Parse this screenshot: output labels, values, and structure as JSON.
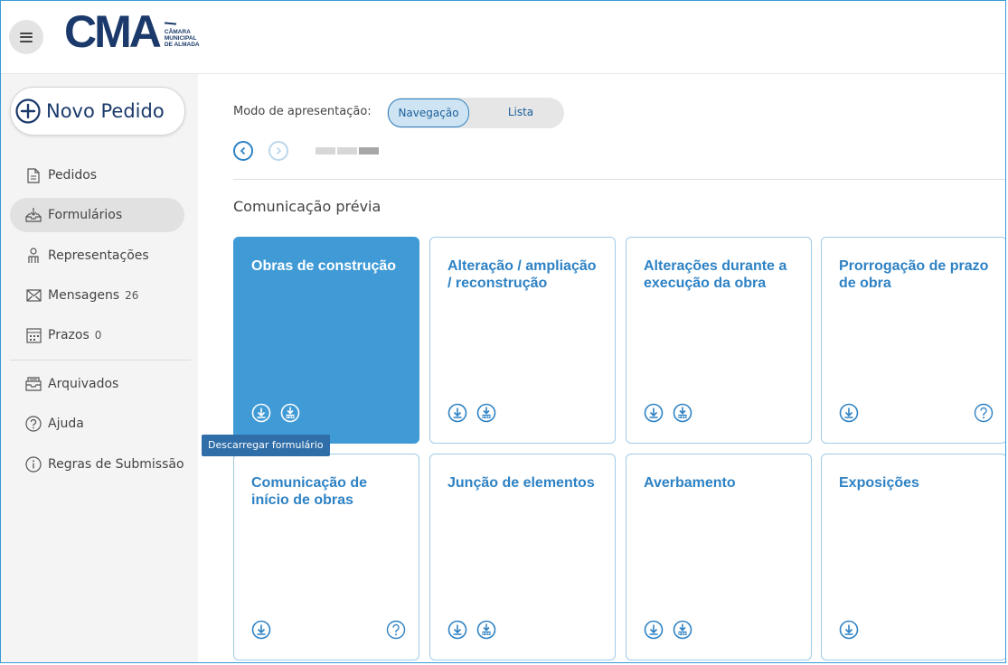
{
  "header": {
    "logo_text": "CMA",
    "logo_sub_lines": [
      "CÂMARA",
      "MUNICIPAL",
      "DE ALMADA"
    ]
  },
  "sidebar": {
    "new_request_label": "Novo Pedido",
    "items": [
      {
        "label": "Pedidos",
        "icon": "document-icon"
      },
      {
        "label": "Formulários",
        "icon": "inbox-download-icon",
        "active": true
      },
      {
        "label": "Representações",
        "icon": "person-icon"
      },
      {
        "label": "Mensagens",
        "count": "26",
        "icon": "envelope-icon"
      },
      {
        "label": "Prazos",
        "count": "0",
        "icon": "calendar-icon"
      },
      {
        "label": "Arquivados",
        "icon": "archive-icon"
      },
      {
        "label": "Ajuda",
        "icon": "question-icon"
      },
      {
        "label": "Regras de Submissão",
        "icon": "info-icon"
      }
    ]
  },
  "main": {
    "mode_label": "Modo de apresentação:",
    "mode_options": [
      "Navegação",
      "Lista"
    ],
    "mode_selected": "Navegação",
    "section_title": "Comunicação prévia",
    "cards": [
      {
        "title": "Obras de construção",
        "selected": true,
        "pdf": true,
        "help": false
      },
      {
        "title": "Alteração / ampliação / reconstrução",
        "pdf": true,
        "help": false
      },
      {
        "title": "Alterações durante a execução da obra",
        "pdf": true,
        "help": false
      },
      {
        "title": "Prorrogação de prazo de obra",
        "pdf": false,
        "help": true
      },
      {
        "title": "Comunicação de início de obras",
        "pdf": false,
        "help": true
      },
      {
        "title": "Junção de elementos",
        "pdf": true,
        "help": false
      },
      {
        "title": "Averbamento",
        "pdf": true,
        "help": false
      },
      {
        "title": "Exposições",
        "pdf": false,
        "help": false
      }
    ],
    "tooltip": "Descarregar formulário"
  },
  "colors": {
    "accent": "#2e82c4",
    "card_selected": "#3f9ad6",
    "logo": "#1b3a6b"
  }
}
